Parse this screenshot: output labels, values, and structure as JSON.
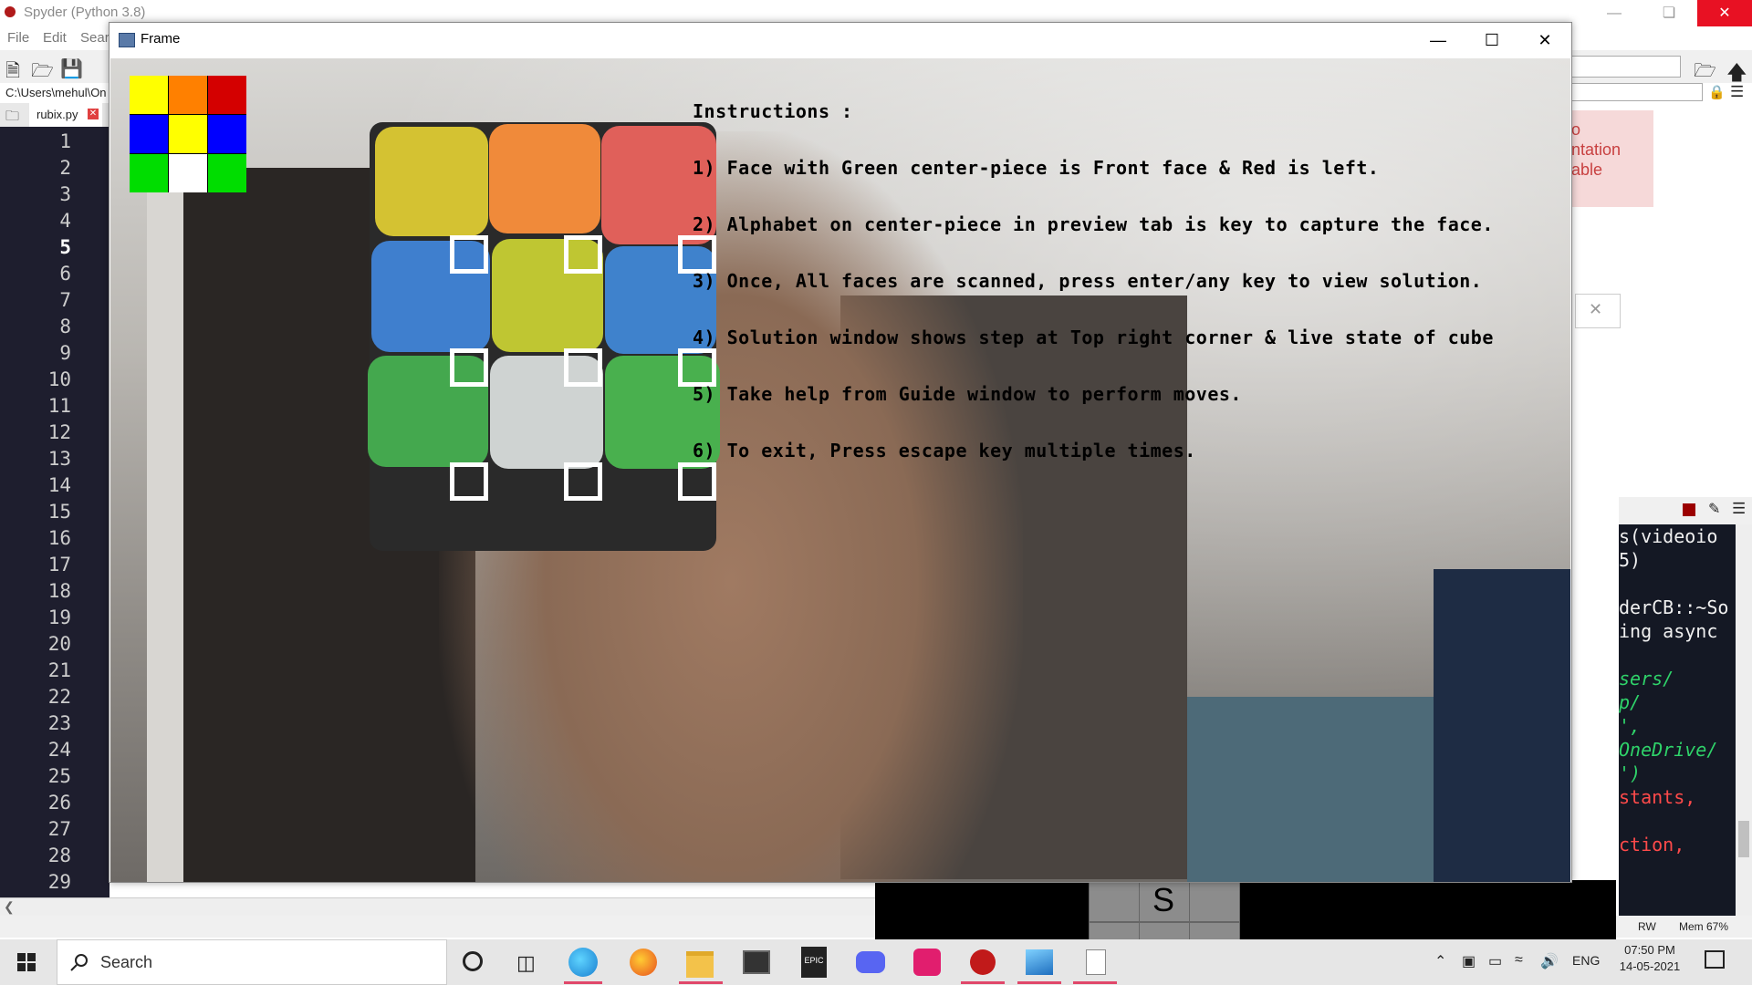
{
  "spyder": {
    "title": "Spyder (Python 3.8)",
    "menu": [
      "File",
      "Edit",
      "Sear"
    ],
    "path": "C:\\Users\\mehul\\On",
    "tab": "rubix.py",
    "line_numbers": [
      "1",
      "2",
      "3",
      "4",
      "5",
      "6",
      "7",
      "8",
      "9",
      "10",
      "11",
      "12",
      "13",
      "14",
      "15",
      "16",
      "17",
      "18",
      "19",
      "20",
      "21",
      "22",
      "23",
      "24",
      "25",
      "26",
      "27",
      "28",
      "29"
    ],
    "current_line": "5",
    "notice_lines": [
      "o",
      "ntation",
      "able"
    ],
    "console_lines": [
      "s(videoio",
      "5)",
      "",
      "derCB::~So",
      "ing async",
      "",
      "sers/",
      "p/",
      "',",
      "OneDrive/",
      "')",
      "stants,",
      "",
      "ction,"
    ],
    "status": {
      "rw": "RW",
      "mem": "Mem 67%"
    }
  },
  "frame": {
    "title": "Frame",
    "instructions_title": "Instructions :",
    "instructions": [
      "1) Face with Green center-piece is Front face & Red is left.",
      "2) Alphabet on center-piece in preview tab is key to capture the face.",
      "3) Once, All faces are scanned, press enter/any key to view solution.",
      "4) Solution window shows step at Top right corner & live state of cube",
      "5) Take help from Guide window to perform moves.",
      "6) To exit, Press escape key multiple times."
    ],
    "preview_colors": [
      "#ffff00",
      "#ff8000",
      "#d40000",
      "#0000ff",
      "#ffff00",
      "#0000ff",
      "#00dd00",
      "#ffffff",
      "#00dd00"
    ],
    "cube_colors": [
      "#d4c232",
      "#f08a3a",
      "#e0605a",
      "#3f7fce",
      "#bfc632",
      "#3f82cc",
      "#44a84e",
      "#cfd3d2",
      "#49b04e"
    ]
  },
  "solution": {
    "center_letter": "S"
  },
  "taskbar": {
    "search_placeholder": "Search",
    "time": "07:50 PM",
    "date": "14-05-2021",
    "lang": "ENG"
  }
}
